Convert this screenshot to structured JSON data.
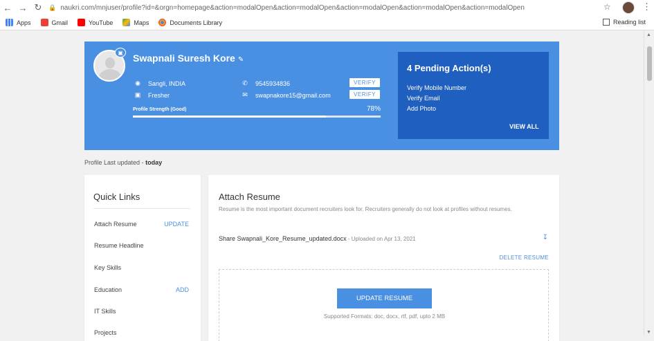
{
  "browser": {
    "url": "naukri.com/mnjuser/profile?id=&orgn=homepage&action=modalOpen&action=modalOpen&action=modalOpen&action=modalOpen&action=modalOpen",
    "bookmarks": [
      "Apps",
      "Gmail",
      "YouTube",
      "Maps",
      "Documents Library"
    ],
    "reading_list": "Reading list"
  },
  "profile": {
    "name": "Swapnali Suresh Kore",
    "location": "Sangli, INDIA",
    "experience": "Fresher",
    "phone": "9545934836",
    "email": "swapnakore15@gmail.com",
    "verify_label": "VERIFY",
    "strength_label": "Profile Strength (Good)",
    "strength_pct_text": "78%",
    "strength_value": 0.78
  },
  "pending": {
    "title": "4 Pending Action(s)",
    "items": [
      "Verify Mobile Number",
      "Verify Email",
      "Add Photo"
    ],
    "view_all": "VIEW ALL"
  },
  "last_updated": {
    "prefix": "Profile Last updated -",
    "value": "today"
  },
  "quick_links": {
    "title": "Quick Links",
    "items": [
      {
        "label": "Attach Resume",
        "action": "UPDATE"
      },
      {
        "label": "Resume Headline",
        "action": ""
      },
      {
        "label": "Key Skills",
        "action": ""
      },
      {
        "label": "Education",
        "action": "ADD"
      },
      {
        "label": "IT Skills",
        "action": ""
      },
      {
        "label": "Projects",
        "action": ""
      }
    ]
  },
  "attach_resume": {
    "title": "Attach Resume",
    "description": "Resume is the most important document recruiters look for. Recruiters generally do not look at profiles without resumes.",
    "file_name": "Share Swapnali_Kore_Resume_updated.docx",
    "uploaded": " - Uploaded on Apr 13, 2021",
    "delete_label": "DELETE RESUME",
    "update_label": "UPDATE RESUME",
    "formats": "Supported Formats: doc, docx, rtf, pdf, upto 2 MB"
  },
  "colors": {
    "brand_blue": "#4a90e2",
    "pending_blue": "#1f5fbf"
  }
}
